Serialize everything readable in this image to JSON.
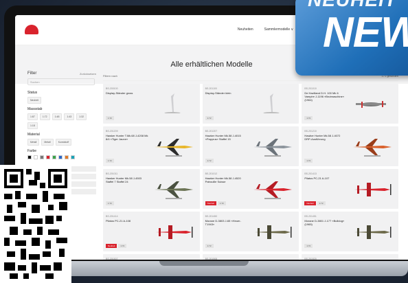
{
  "header": {
    "nav": [
      "Neuheiten",
      "Sammlermodelle ∨",
      "Zoom"
    ]
  },
  "page": {
    "title": "Alle erhältlichen Modelle"
  },
  "sidebar": {
    "title": "Filter",
    "reset": "Zurücksetzen",
    "search_placeholder": "Suchen",
    "status_label": "Status",
    "status_chips": [
      "Neuheit"
    ],
    "scale_label": "Massstab",
    "scale_chips": [
      "1:87",
      "1:72",
      "1:48",
      "1:43",
      "1:32",
      "1:18"
    ],
    "material_label": "Material",
    "material_chips": [
      "Metall",
      "Metall",
      "Kunststoff"
    ],
    "color_label": "Farbe",
    "colors": [
      "#111111",
      "#ffffff",
      "#777777",
      "#d9232d",
      "#3aa34a",
      "#2b67c6",
      "#e07b2a",
      "#1aa3b8"
    ]
  },
  "filter_bar": {
    "placeholder": "Filtern nach",
    "count": "171 gefunden"
  },
  "products": [
    {
      "sku": "BS-200100",
      "name": "Display-Ständer gross",
      "badges": [
        "1:72"
      ],
      "img": "stand"
    },
    {
      "sku": "BS-201100",
      "name": "Display-Ständer klein",
      "badges": [
        "1:72"
      ],
      "img": "stand"
    },
    {
      "sku": "BS-201010",
      "name": "De Havilland D.H. 100 Mk 6 Vampire J-1196 «Brutmaschine» (1964)",
      "badges": [
        "1:72"
      ],
      "img": "vampire"
    },
    {
      "sku": "BS-201209",
      "name": "Hawker Hunter T.Mk.68 J-4208 Mk 8/4 «Tiger Jaune»",
      "badges": [
        "1:72"
      ],
      "img": "jet-yellow"
    },
    {
      "sku": "BS-201207",
      "name": "Hawker Hunter Mk.58 J-4015 «Papyrus» Staffel 15",
      "badges": [
        "1:72"
      ],
      "img": "jet-grey"
    },
    {
      "sku": "BS-201210",
      "name": "Hawker Hunter Mk.58 J-4072 DRP-Ausführung",
      "badges": [
        "1:72"
      ],
      "img": "jet-orange"
    },
    {
      "sku": "BS-201011",
      "name": "Hawker Hunter Mk.58 J-4503 Staffel 7 Staffel 24",
      "badges": [
        "1:72"
      ],
      "img": "jet-camo"
    },
    {
      "sku": "BS-201012",
      "name": "Hawker Hunter Mk.58 J-4520 Patrouille Suisse",
      "badges": [
        "Neuheit",
        "1:72"
      ],
      "img": "jet-red"
    },
    {
      "sku": "BS-201413",
      "name": "Pilatus PC-21 A-107",
      "badges": [
        "Neuheit",
        "1:72"
      ],
      "img": "prop-red"
    },
    {
      "sku": "BS-201414",
      "name": "Pilatus PC-21 A-108",
      "badges": [
        "Neuheit",
        "1:72"
      ],
      "img": "prop-red"
    },
    {
      "sku": "BS-201450",
      "name": "Morane D-3803 J-65 «Heuer-T1943»",
      "badges": [
        "1:72"
      ],
      "img": "prop-camo"
    },
    {
      "sku": "BS-201451",
      "name": "Morane D-3801 J-177 «Bulldog» (1965)",
      "badges": [
        "1:72"
      ],
      "img": "prop-camo"
    },
    {
      "sku": "BS-201507",
      "name": "Cougar AS332 T-312 Lufttransportstaffel",
      "badges": [
        "Neuheit",
        "1:72"
      ],
      "img": "heli-dark"
    },
    {
      "sku": "BS-201508",
      "name": "Cougar AS332 T-336 LT-Staffel 6",
      "badges": [
        "1:72"
      ],
      "img": "heli-dark"
    },
    {
      "sku": "BS-201520",
      "name": "Alouette III V-271",
      "badges": [
        "1:72"
      ],
      "img": "heli-green"
    }
  ],
  "ribbon": {
    "line1": "NEUHEIT",
    "line2": "NEW"
  }
}
